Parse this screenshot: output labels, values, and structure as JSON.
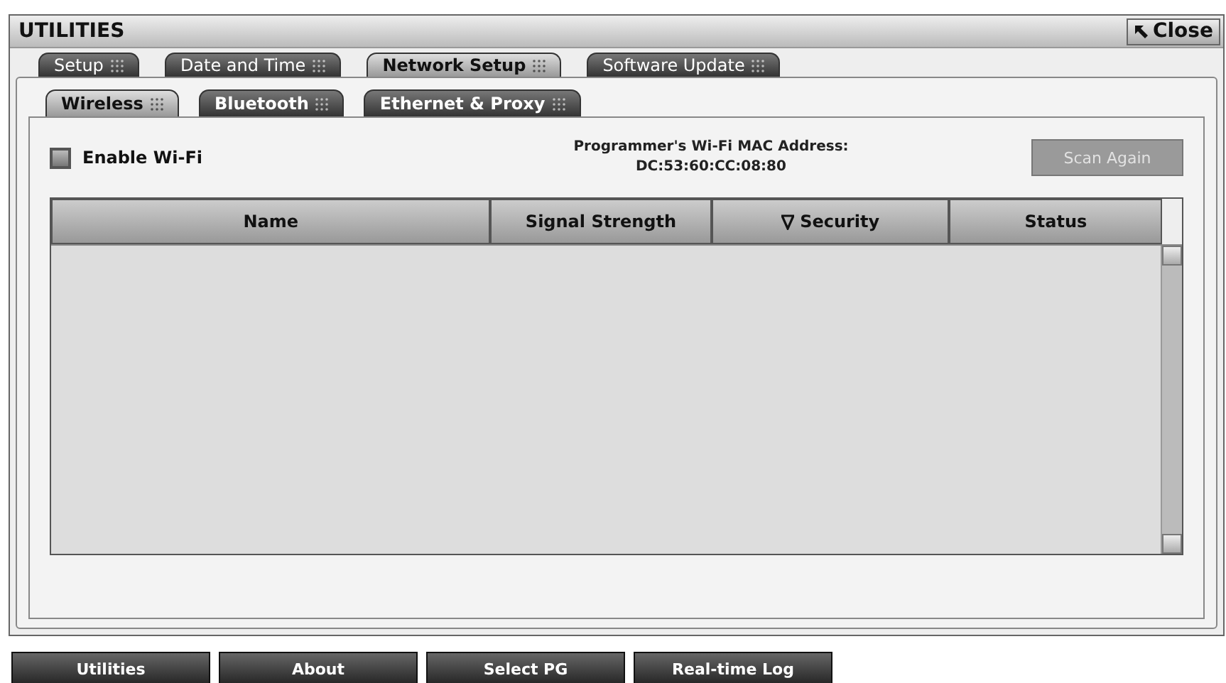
{
  "window": {
    "title": "UTILITIES",
    "close_button": "Close"
  },
  "tabs": [
    {
      "label": "Setup",
      "selected": false
    },
    {
      "label": "Date and Time",
      "selected": false
    },
    {
      "label": "Network Setup",
      "selected": true
    },
    {
      "label": "Software Update",
      "selected": false
    }
  ],
  "subtabs": [
    {
      "label": "Wireless",
      "selected": true
    },
    {
      "label": "Bluetooth",
      "selected": false
    },
    {
      "label": "Ethernet & Proxy",
      "selected": false
    }
  ],
  "wifi": {
    "enable_label": "Enable Wi-Fi",
    "checked": false,
    "mac_label": "Programmer's Wi-Fi MAC Address:",
    "mac_value": "DC:53:60:CC:08:80",
    "scan_button": "Scan Again",
    "scan_disabled": true
  },
  "table": {
    "columns": [
      {
        "label": "Name",
        "sorted": false
      },
      {
        "label": "Signal Strength",
        "sorted": false
      },
      {
        "label": "Security",
        "sorted": true
      },
      {
        "label": "Status",
        "sorted": false
      }
    ]
  },
  "bottom_buttons": [
    "Utilities",
    "About",
    "Select PG",
    "Real-time Log"
  ]
}
